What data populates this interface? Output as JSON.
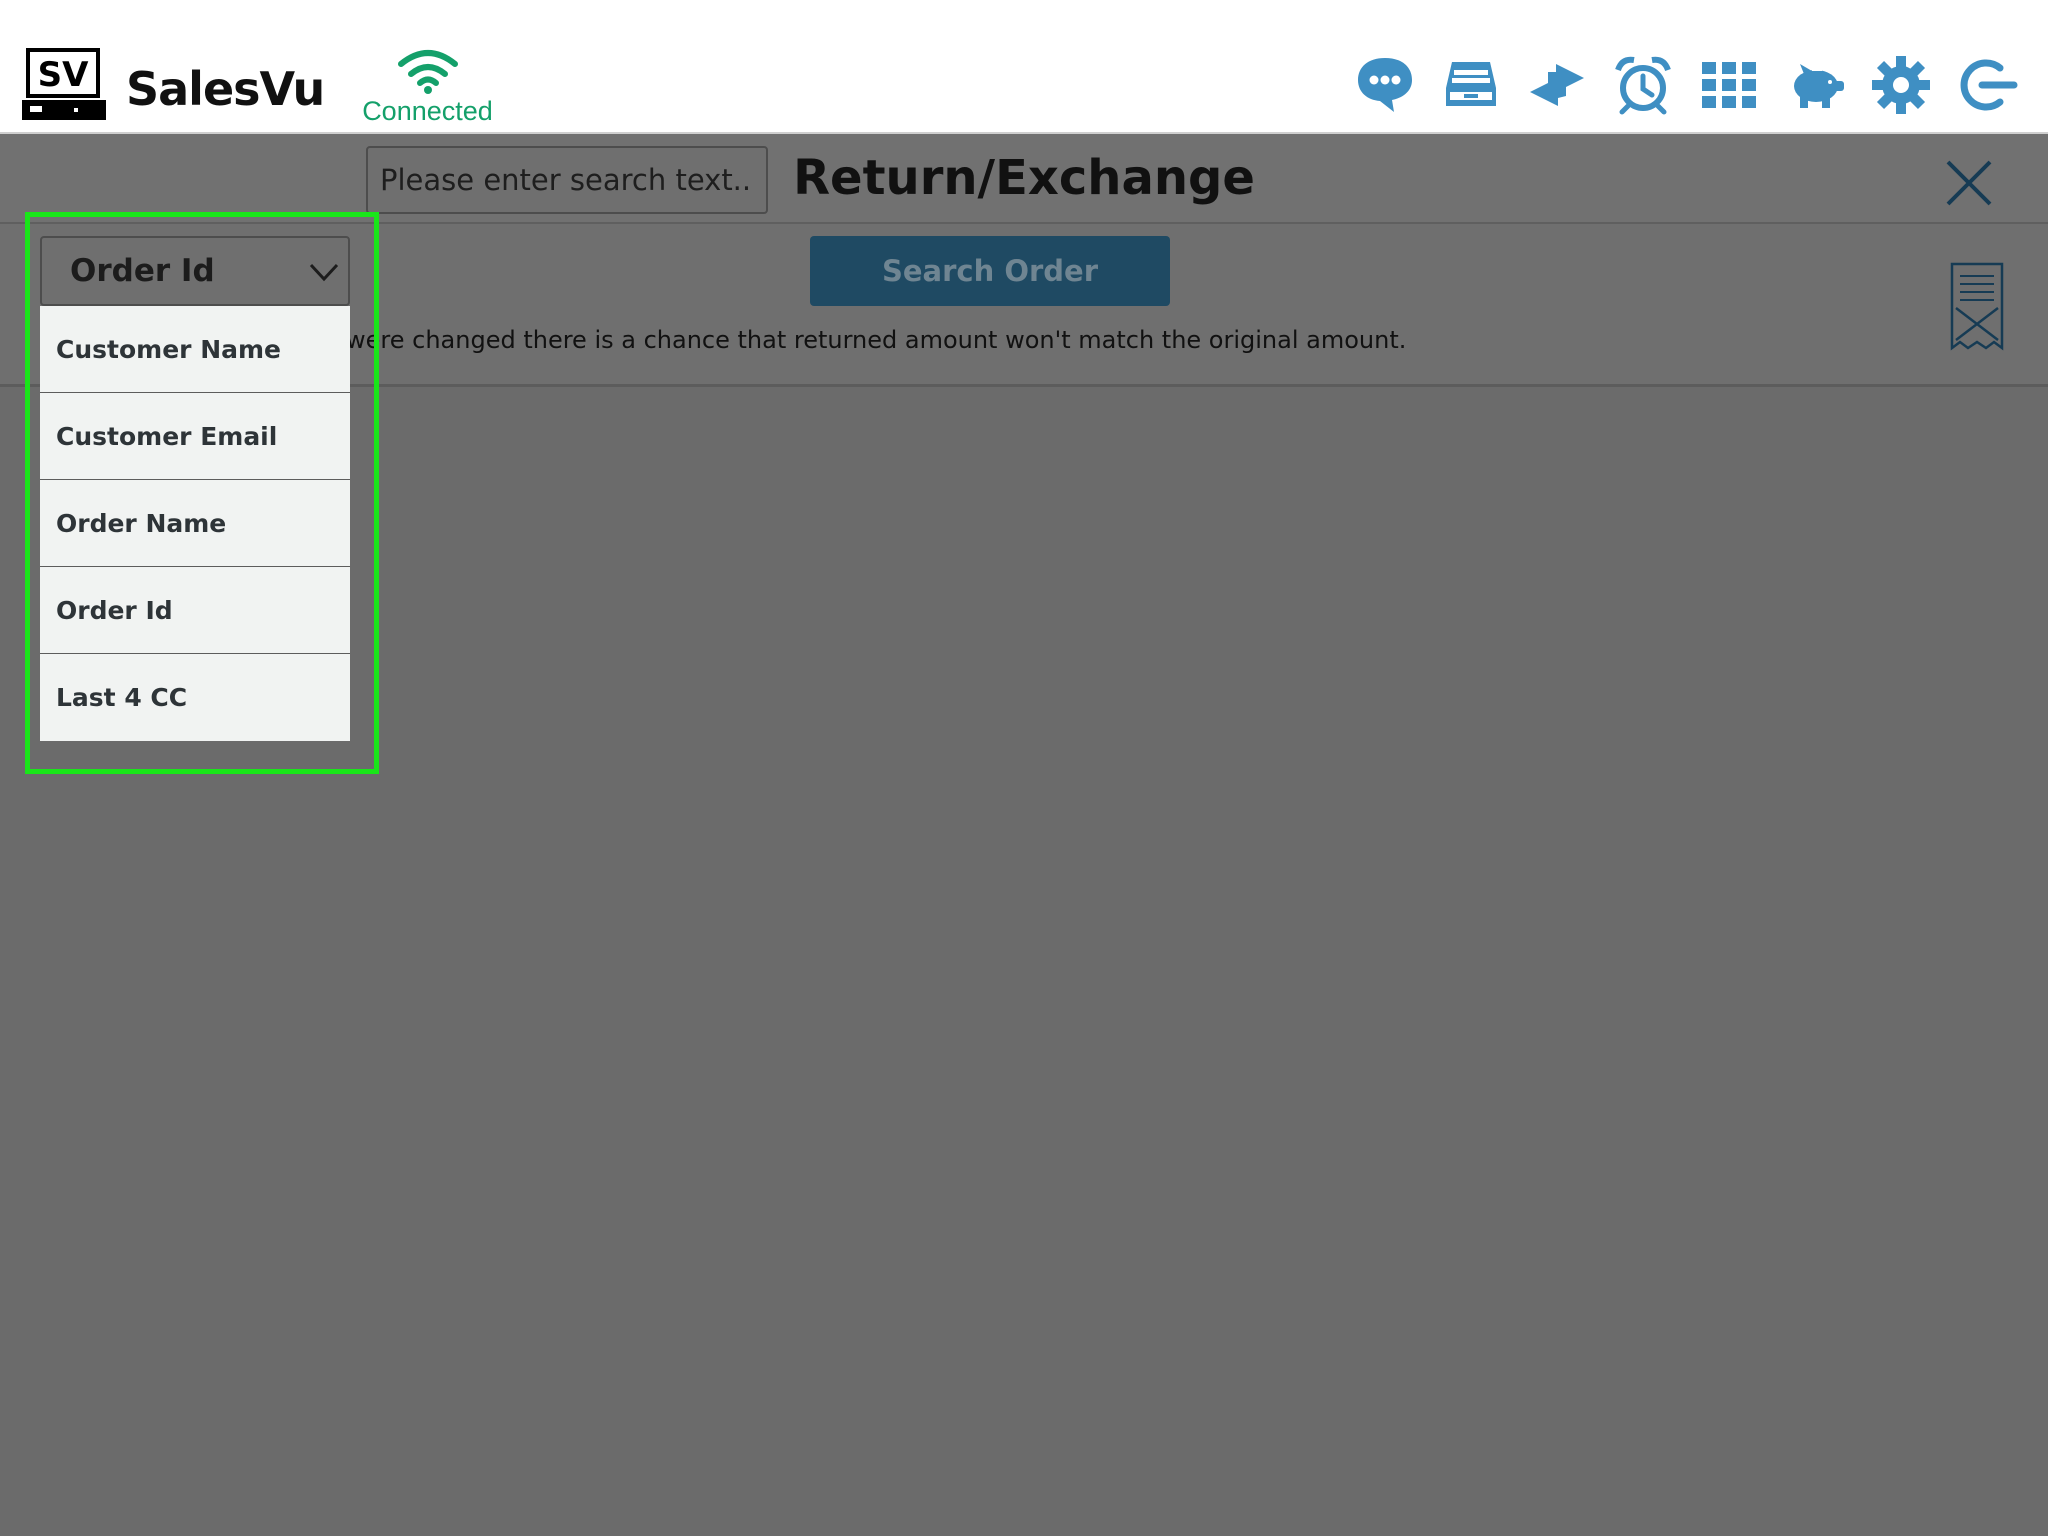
{
  "app": {
    "brand": "SalesVu",
    "connection_status": "Connected"
  },
  "topbar_icons": [
    "chat-icon",
    "cash-drawer-icon",
    "transfer-icon",
    "alarm-clock-icon",
    "grid-icon",
    "piggy-bank-icon",
    "settings-gear-icon",
    "logout-icon"
  ],
  "colors": {
    "accent_blue": "#3f8fc3",
    "connected_green": "#14a06a",
    "search_button": "#1f4a63",
    "highlight_green": "#19e619"
  },
  "screen": {
    "title": "Return/Exchange",
    "search": {
      "field_selected": "Order Id",
      "placeholder": "Please enter search text...",
      "button_label": "Search Order"
    },
    "warning_text": "were changed there is a chance that returned amount won't match the original amount."
  },
  "dropdown": {
    "options": [
      "Customer Name",
      "Customer Email",
      "Order Name",
      "Order Id",
      "Last 4 CC"
    ]
  }
}
